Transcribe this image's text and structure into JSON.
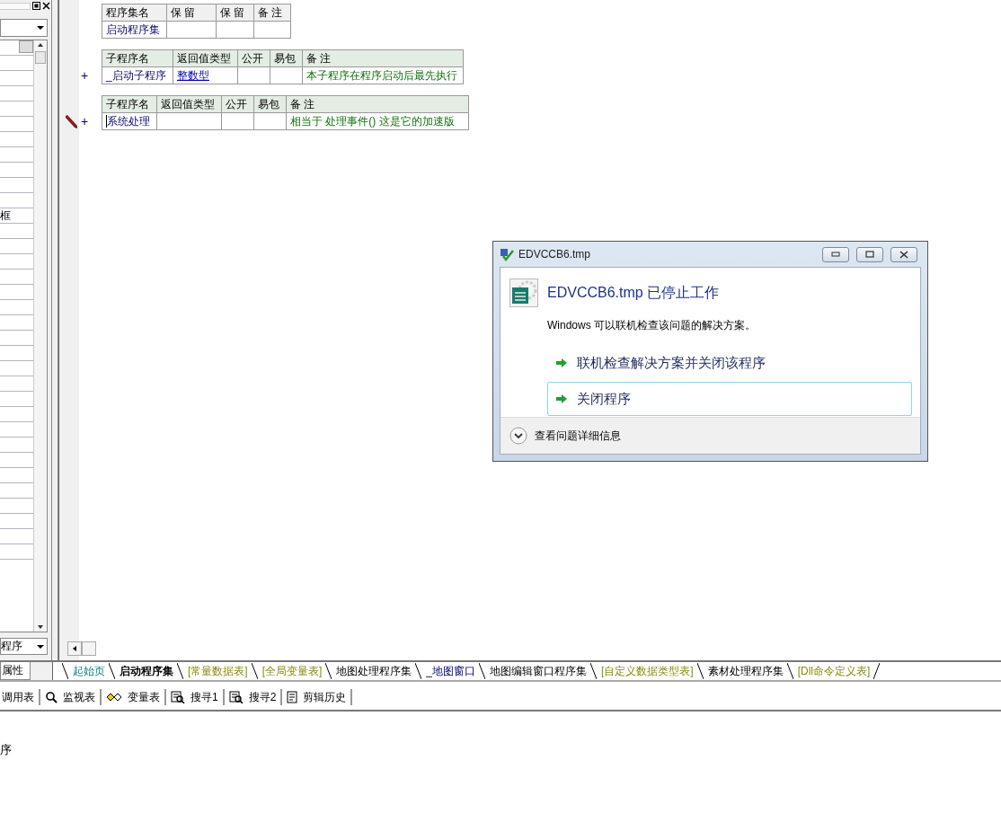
{
  "left_panel": {
    "property_rows": [
      {
        "value": "框"
      }
    ],
    "object_dropdown": {
      "value": "程序"
    },
    "tab": {
      "label": "属性",
      "selected": true
    }
  },
  "editor": {
    "tables": [
      {
        "kind": "assembly",
        "columns": [
          "程序集名",
          "保 留",
          "保 留",
          "备 注"
        ],
        "rows": [
          {
            "marker": "",
            "editing": false,
            "cells": [
              {
                "kind": "name",
                "text": "启动程序集"
              },
              {
                "kind": "blank"
              },
              {
                "kind": "blank"
              },
              {
                "kind": "blank"
              }
            ]
          }
        ]
      },
      {
        "kind": "subroutine",
        "columns": [
          "子程序名",
          "返回值类型",
          "公开",
          "易包",
          "备 注"
        ],
        "rows": [
          {
            "marker": "+",
            "editing": false,
            "cells": [
              {
                "kind": "name",
                "text": "_启动子程序"
              },
              {
                "kind": "type",
                "text": "整数型"
              },
              {
                "kind": "blank"
              },
              {
                "kind": "blank"
              },
              {
                "kind": "comment",
                "text": "本子程序在程序启动后最先执行"
              }
            ]
          }
        ]
      },
      {
        "kind": "subroutine",
        "columns": [
          "子程序名",
          "返回值类型",
          "公开",
          "易包",
          "备 注"
        ],
        "rows": [
          {
            "marker": "+",
            "editing": true,
            "cells": [
              {
                "kind": "name",
                "text": "系统处理"
              },
              {
                "kind": "blank"
              },
              {
                "kind": "blank"
              },
              {
                "kind": "blank"
              },
              {
                "kind": "comment",
                "text": "相当于 处理事件() 这是它的加速版"
              }
            ]
          }
        ]
      }
    ]
  },
  "tabs": [
    {
      "label": "起始页",
      "kind": "page",
      "selected": false
    },
    {
      "label": "启动程序集",
      "kind": "program",
      "selected": true
    },
    {
      "label": "[常量数据表]",
      "kind": "table",
      "selected": false
    },
    {
      "label": "[全局变量表]",
      "kind": "table",
      "selected": false
    },
    {
      "label": "地图处理程序集",
      "kind": "program",
      "selected": false
    },
    {
      "label": "_地图窗口",
      "kind": "window",
      "selected": false
    },
    {
      "label": "地图编辑窗口程序集",
      "kind": "program",
      "selected": false
    },
    {
      "label": "[自定义数据类型表]",
      "kind": "table",
      "selected": false
    },
    {
      "label": "素材处理程序集",
      "kind": "program",
      "selected": false
    },
    {
      "label": "[Dll命令定义表]",
      "kind": "table",
      "selected": false
    }
  ],
  "toolbar": [
    {
      "label": "调用表",
      "kind": "none"
    },
    {
      "label": "监视表",
      "kind": "magnifier"
    },
    {
      "label": "变量表",
      "kind": "glasses"
    },
    {
      "label": "搜寻1",
      "kind": "find"
    },
    {
      "label": "搜寻2",
      "kind": "find"
    },
    {
      "label": "剪辑历史",
      "kind": "document"
    }
  ],
  "output": {
    "text": "序"
  },
  "dialog": {
    "title": "EDVCCB6.tmp",
    "heading": "EDVCCB6.tmp 已停止工作",
    "message": "Windows 可以联机检查该问题的解决方案。",
    "options": [
      {
        "label": "联机检查解决方案并关闭该程序",
        "selected": false
      },
      {
        "label": "关闭程序",
        "selected": true
      }
    ],
    "details": "查看问题详细信息"
  }
}
